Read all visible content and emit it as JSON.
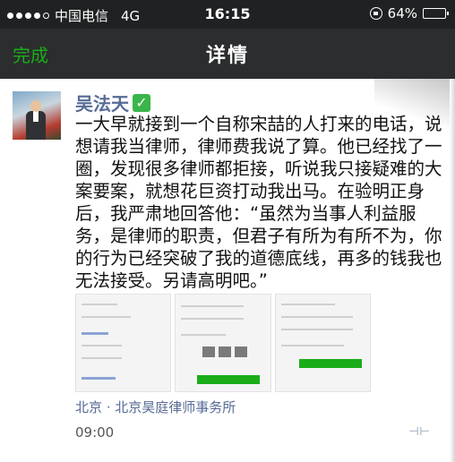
{
  "status_bar": {
    "carrier": "中国电信",
    "network": "4G",
    "time": "16:15",
    "battery": "64%",
    "battery_level": 0.64
  },
  "nav": {
    "done_label": "完成",
    "title": "详情"
  },
  "post": {
    "author": "吴法天",
    "verified_mark": "✓",
    "text": "一大早就接到一个自称宋喆的人打来的电话，说想请我当律师，律师费我说了算。他已经找了一圈，发现很多律师都拒接，听说我只接疑难的大案要案，就想花巨资打动我出马。在验明正身后，我严肃地回答他：“虽然为当事人利益服务，是律师的职责，但君子有所为有所不为，你的行为已经突破了我的道德底线，再多的钱我也无法接受。另请高明吧。”",
    "location": "北京 · 北京昊庭律师事务所",
    "time": "09:00"
  },
  "colors": {
    "link_blue": "#576b95",
    "wechat_green": "#1aad19",
    "nav_bg": "#2b2d2e"
  }
}
